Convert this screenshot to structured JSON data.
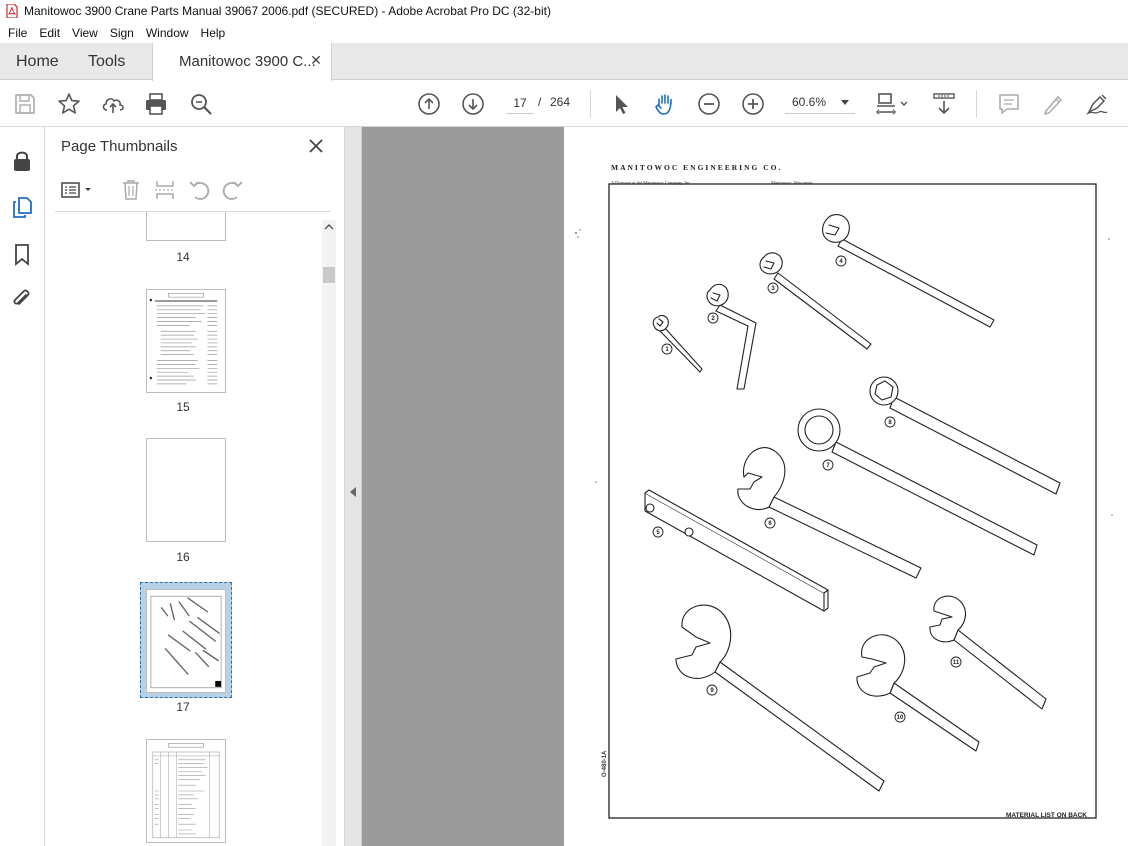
{
  "window": {
    "title": "Manitowoc 3900 Crane Parts Manual 39067 2006.pdf (SECURED) - Adobe Acrobat Pro DC (32-bit)"
  },
  "menu": [
    "File",
    "Edit",
    "View",
    "Sign",
    "Window",
    "Help"
  ],
  "tabs": {
    "home": "Home",
    "tools": "Tools",
    "document": "Manitowoc 3900 C..."
  },
  "toolbar": {
    "current_page": "17",
    "page_separator": "/",
    "total_pages": "264",
    "zoom": "60.6%"
  },
  "thumbnail_panel": {
    "title": "Page Thumbnails",
    "pages": [
      {
        "label": "14"
      },
      {
        "label": "15"
      },
      {
        "label": "16"
      },
      {
        "label": "17",
        "selected": true
      },
      {
        "label": ""
      }
    ]
  },
  "document_page": {
    "header": "MANITOWOC ENGINEERING CO.",
    "sub_left": "A Division of the Manitowoc Company, Inc",
    "sub_right": "Manitowoc, Wisconsin",
    "footer": "MATERIAL LIST ON BACK",
    "doc_number": "O-480-1A",
    "callouts": [
      "1",
      "2",
      "3",
      "4",
      "5",
      "6",
      "7",
      "8",
      "9",
      "10",
      "11"
    ]
  }
}
